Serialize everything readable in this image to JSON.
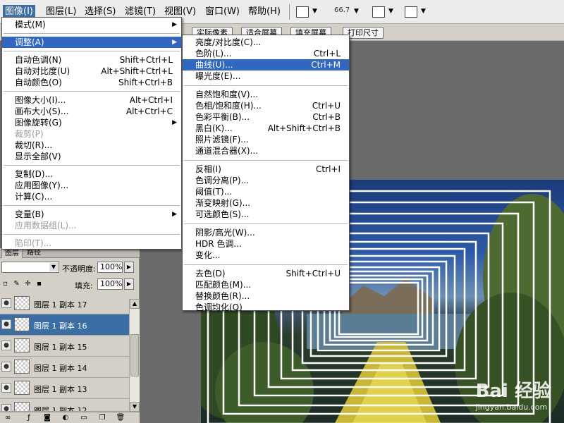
{
  "menubar": {
    "items": [
      "图像(I)",
      "图层(L)",
      "选择(S)",
      "滤镜(T)",
      "视图(V)",
      "窗口(W)",
      "帮助(H)"
    ],
    "zoom": "66.7"
  },
  "options_bar": {
    "buttons": [
      "实际像素",
      "适合屏幕",
      "填充屏幕",
      "打印尺寸"
    ]
  },
  "image_menu": {
    "items": [
      {
        "label": "模式(M)",
        "shortcut": "",
        "submenu": true,
        "disabled": false,
        "highlighted": false
      },
      {
        "sep": true
      },
      {
        "label": "调整(A)",
        "shortcut": "",
        "submenu": true,
        "disabled": false,
        "highlighted": true
      },
      {
        "sep": true
      },
      {
        "label": "自动色调(N)",
        "shortcut": "Shift+Ctrl+L",
        "submenu": false,
        "disabled": false,
        "highlighted": false
      },
      {
        "label": "自动对比度(U)",
        "shortcut": "Alt+Shift+Ctrl+L",
        "submenu": false,
        "disabled": false,
        "highlighted": false
      },
      {
        "label": "自动颜色(O)",
        "shortcut": "Shift+Ctrl+B",
        "submenu": false,
        "disabled": false,
        "highlighted": false
      },
      {
        "sep": true
      },
      {
        "label": "图像大小(I)...",
        "shortcut": "Alt+Ctrl+I",
        "submenu": false,
        "disabled": false,
        "highlighted": false
      },
      {
        "label": "画布大小(S)...",
        "shortcut": "Alt+Ctrl+C",
        "submenu": false,
        "disabled": false,
        "highlighted": false
      },
      {
        "label": "图像旋转(G)",
        "shortcut": "",
        "submenu": true,
        "disabled": false,
        "highlighted": false
      },
      {
        "label": "裁剪(P)",
        "shortcut": "",
        "submenu": false,
        "disabled": true,
        "highlighted": false
      },
      {
        "label": "裁切(R)...",
        "shortcut": "",
        "submenu": false,
        "disabled": false,
        "highlighted": false
      },
      {
        "label": "显示全部(V)",
        "shortcut": "",
        "submenu": false,
        "disabled": false,
        "highlighted": false
      },
      {
        "sep": true
      },
      {
        "label": "复制(D)...",
        "shortcut": "",
        "submenu": false,
        "disabled": false,
        "highlighted": false
      },
      {
        "label": "应用图像(Y)...",
        "shortcut": "",
        "submenu": false,
        "disabled": false,
        "highlighted": false
      },
      {
        "label": "计算(C)...",
        "shortcut": "",
        "submenu": false,
        "disabled": false,
        "highlighted": false
      },
      {
        "sep": true
      },
      {
        "label": "变量(B)",
        "shortcut": "",
        "submenu": true,
        "disabled": false,
        "highlighted": false
      },
      {
        "label": "应用数据组(L)...",
        "shortcut": "",
        "submenu": false,
        "disabled": true,
        "highlighted": false
      },
      {
        "sep": true
      },
      {
        "label": "陷印(T)...",
        "shortcut": "",
        "submenu": false,
        "disabled": true,
        "highlighted": false
      }
    ]
  },
  "adjust_menu": {
    "items": [
      {
        "label": "亮度/对比度(C)...",
        "shortcut": "",
        "highlighted": false
      },
      {
        "label": "色阶(L)...",
        "shortcut": "Ctrl+L",
        "highlighted": false
      },
      {
        "label": "曲线(U)...",
        "shortcut": "Ctrl+M",
        "highlighted": true
      },
      {
        "label": "曝光度(E)...",
        "shortcut": "",
        "highlighted": false
      },
      {
        "sep": true
      },
      {
        "label": "自然饱和度(V)...",
        "shortcut": "",
        "highlighted": false
      },
      {
        "label": "色相/饱和度(H)...",
        "shortcut": "Ctrl+U",
        "highlighted": false
      },
      {
        "label": "色彩平衡(B)...",
        "shortcut": "Ctrl+B",
        "highlighted": false
      },
      {
        "label": "黑白(K)...",
        "shortcut": "Alt+Shift+Ctrl+B",
        "highlighted": false
      },
      {
        "label": "照片滤镜(F)...",
        "shortcut": "",
        "highlighted": false
      },
      {
        "label": "通道混合器(X)...",
        "shortcut": "",
        "highlighted": false
      },
      {
        "sep": true
      },
      {
        "label": "反相(I)",
        "shortcut": "Ctrl+I",
        "highlighted": false
      },
      {
        "label": "色调分离(P)...",
        "shortcut": "",
        "highlighted": false
      },
      {
        "label": "阈值(T)...",
        "shortcut": "",
        "highlighted": false
      },
      {
        "label": "渐变映射(G)...",
        "shortcut": "",
        "highlighted": false
      },
      {
        "label": "可选颜色(S)...",
        "shortcut": "",
        "highlighted": false
      },
      {
        "sep": true
      },
      {
        "label": "阴影/高光(W)...",
        "shortcut": "",
        "highlighted": false
      },
      {
        "label": "HDR 色调...",
        "shortcut": "",
        "highlighted": false
      },
      {
        "label": "变化...",
        "shortcut": "",
        "highlighted": false
      },
      {
        "sep": true
      },
      {
        "label": "去色(D)",
        "shortcut": "Shift+Ctrl+U",
        "highlighted": false
      },
      {
        "label": "匹配颜色(M)...",
        "shortcut": "",
        "highlighted": false
      },
      {
        "label": "替换颜色(R)...",
        "shortcut": "",
        "highlighted": false
      },
      {
        "label": "色调均化(Q)",
        "shortcut": "",
        "highlighted": false
      }
    ]
  },
  "layers_panel": {
    "tabs": [
      "图层",
      "路径"
    ],
    "opacity_label": "不透明度:",
    "opacity_value": "100%",
    "fill_label": "填充:",
    "fill_value": "100%",
    "layers": [
      {
        "name": "图层 1 副本 17",
        "selected": false
      },
      {
        "name": "图层 1 副本 16",
        "selected": true
      },
      {
        "name": "图层 1 副本 15",
        "selected": false
      },
      {
        "name": "图层 1 副本 14",
        "selected": false
      },
      {
        "name": "图层 1 副本 13",
        "selected": false
      },
      {
        "name": "图层 1 副本 12",
        "selected": false
      }
    ]
  },
  "watermark": {
    "logo_text": "Bai 经验",
    "url": "jingyan.baidu.com"
  }
}
